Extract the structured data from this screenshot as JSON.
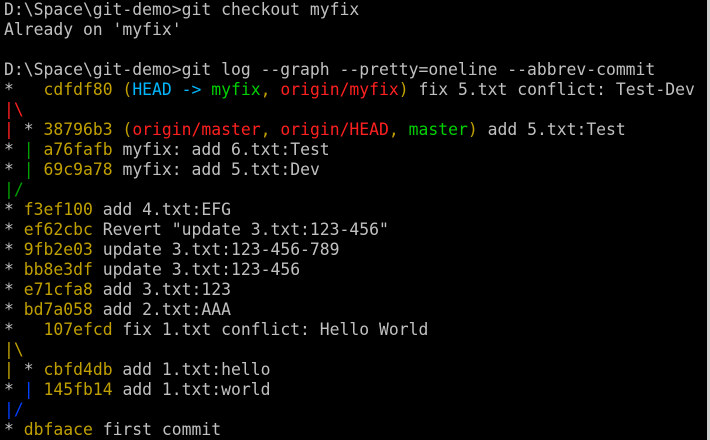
{
  "colors": {
    "background": "#000000",
    "text": "#c0c0c0",
    "hash": "#c0a000",
    "head": "#00b8ff",
    "branch_local": "#00d000",
    "branch_remote": "#ff2020",
    "graph_red": "#ff2020",
    "graph_gold": "#c0a000",
    "graph_green": "#00a000",
    "graph_blue": "#0040ff",
    "graph_white": "#c0c0c0"
  },
  "lines": [
    [
      {
        "t": "D:\\Space\\git-demo>git checkout myfix",
        "c": "text"
      }
    ],
    [
      {
        "t": "Already on 'myfix'",
        "c": "text"
      }
    ],
    [
      {
        "t": "",
        "c": "text"
      }
    ],
    [
      {
        "t": "D:\\Space\\git-demo>git log --graph --pretty=oneline --abbrev-commit",
        "c": "text"
      }
    ],
    [
      {
        "t": "*   ",
        "c": "graph_white"
      },
      {
        "t": "cdfdf80",
        "c": "hash"
      },
      {
        "t": " (",
        "c": "hash"
      },
      {
        "t": "HEAD -> ",
        "c": "head"
      },
      {
        "t": "myfix",
        "c": "branch_local"
      },
      {
        "t": ", ",
        "c": "hash"
      },
      {
        "t": "origin/myfix",
        "c": "branch_remote"
      },
      {
        "t": ")",
        "c": "hash"
      },
      {
        "t": " fix 5.txt conflict: Test-Dev",
        "c": "text"
      }
    ],
    [
      {
        "t": "|\\",
        "c": "graph_red"
      }
    ],
    [
      {
        "t": "|",
        "c": "graph_red"
      },
      {
        "t": " * ",
        "c": "graph_white"
      },
      {
        "t": "38796b3",
        "c": "hash"
      },
      {
        "t": " (",
        "c": "hash"
      },
      {
        "t": "origin/master",
        "c": "branch_remote"
      },
      {
        "t": ", ",
        "c": "hash"
      },
      {
        "t": "origin/HEAD",
        "c": "branch_remote"
      },
      {
        "t": ", ",
        "c": "hash"
      },
      {
        "t": "master",
        "c": "branch_local"
      },
      {
        "t": ")",
        "c": "hash"
      },
      {
        "t": " add 5.txt:Test",
        "c": "text"
      }
    ],
    [
      {
        "t": "* ",
        "c": "graph_white"
      },
      {
        "t": "| ",
        "c": "graph_green"
      },
      {
        "t": "a76fafb",
        "c": "hash"
      },
      {
        "t": " myfix: add 6.txt:Test",
        "c": "text"
      }
    ],
    [
      {
        "t": "* ",
        "c": "graph_white"
      },
      {
        "t": "| ",
        "c": "graph_green"
      },
      {
        "t": "69c9a78",
        "c": "hash"
      },
      {
        "t": " myfix: add 5.txt:Dev",
        "c": "text"
      }
    ],
    [
      {
        "t": "|/",
        "c": "graph_green"
      }
    ],
    [
      {
        "t": "* ",
        "c": "graph_white"
      },
      {
        "t": "f3ef100",
        "c": "hash"
      },
      {
        "t": " add 4.txt:EFG",
        "c": "text"
      }
    ],
    [
      {
        "t": "* ",
        "c": "graph_white"
      },
      {
        "t": "ef62cbc",
        "c": "hash"
      },
      {
        "t": " Revert \"update 3.txt:123-456\"",
        "c": "text"
      }
    ],
    [
      {
        "t": "* ",
        "c": "graph_white"
      },
      {
        "t": "9fb2e03",
        "c": "hash"
      },
      {
        "t": " update 3.txt:123-456-789",
        "c": "text"
      }
    ],
    [
      {
        "t": "* ",
        "c": "graph_white"
      },
      {
        "t": "bb8e3df",
        "c": "hash"
      },
      {
        "t": " update 3.txt:123-456",
        "c": "text"
      }
    ],
    [
      {
        "t": "* ",
        "c": "graph_white"
      },
      {
        "t": "e71cfa8",
        "c": "hash"
      },
      {
        "t": " add 3.txt:123",
        "c": "text"
      }
    ],
    [
      {
        "t": "* ",
        "c": "graph_white"
      },
      {
        "t": "bd7a058",
        "c": "hash"
      },
      {
        "t": " add 2.txt:AAA",
        "c": "text"
      }
    ],
    [
      {
        "t": "*   ",
        "c": "graph_white"
      },
      {
        "t": "107efcd",
        "c": "hash"
      },
      {
        "t": " fix 1.txt conflict: Hello World",
        "c": "text"
      }
    ],
    [
      {
        "t": "|\\",
        "c": "graph_gold"
      }
    ],
    [
      {
        "t": "|",
        "c": "graph_gold"
      },
      {
        "t": " * ",
        "c": "graph_white"
      },
      {
        "t": "cbfd4db",
        "c": "hash"
      },
      {
        "t": " add 1.txt:hello",
        "c": "text"
      }
    ],
    [
      {
        "t": "* ",
        "c": "graph_white"
      },
      {
        "t": "| ",
        "c": "graph_blue"
      },
      {
        "t": "145fb14",
        "c": "hash"
      },
      {
        "t": " add 1.txt:world",
        "c": "text"
      }
    ],
    [
      {
        "t": "|/",
        "c": "graph_blue"
      }
    ],
    [
      {
        "t": "* ",
        "c": "graph_white"
      },
      {
        "t": "dbfaace",
        "c": "hash"
      },
      {
        "t": " first commit",
        "c": "text"
      }
    ]
  ]
}
